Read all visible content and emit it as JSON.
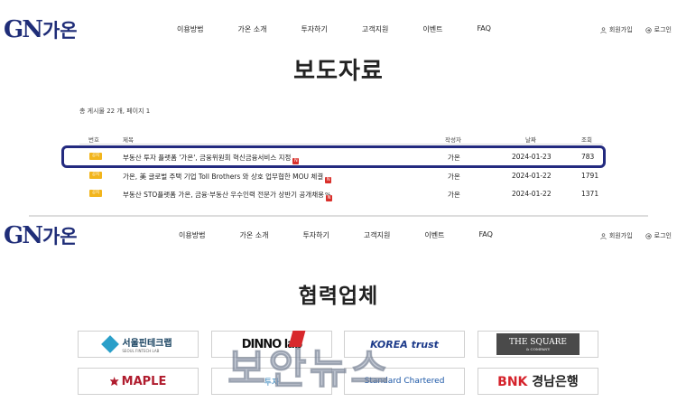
{
  "brand": {
    "logo_mark": "GN",
    "logo_text": "가온"
  },
  "nav": [
    "이용방법",
    "가온 소개",
    "투자하기",
    "고객지원",
    "이벤트",
    "FAQ"
  ],
  "util": {
    "signup": "회원가입",
    "login": "로그인"
  },
  "press": {
    "title": "보도자료",
    "count_text": "총 게시물 22 개, 페이지 1",
    "columns": {
      "no": "번호",
      "title": "제목",
      "author": "작성자",
      "date": "날짜",
      "views": "조회"
    },
    "badge": "공지",
    "new_mark": "N",
    "rows": [
      {
        "title": "부동산 투자 플랫폼 '가온', 금융위원회 혁신금융서비스 지정",
        "author": "가온",
        "date": "2024-01-23",
        "views": "783"
      },
      {
        "title": "가온, 美 글로벌 주택 기업 Toll Brothers 와 상호 업무협한 MOU 체결",
        "author": "가온",
        "date": "2024-01-22",
        "views": "1791"
      },
      {
        "title": "부동산 STO플랫폼 가온, 금융·부동산 우수인력 전문가 상반기 공개채용",
        "author": "가온",
        "date": "2024-01-22",
        "views": "1371"
      }
    ]
  },
  "partners": {
    "title": "협력업체",
    "items": [
      {
        "name": "서울핀테크랩",
        "sub": "SEOUL FINTECH LAB"
      },
      {
        "name": "DINNO lab"
      },
      {
        "name": "KOREA trust"
      },
      {
        "name": "THE SQUARE",
        "sub": "& COMPANY"
      },
      {
        "name": "MAPLE"
      },
      {
        "name": "투자"
      },
      {
        "name": "Standard Chartered"
      },
      {
        "name": "BNK",
        "sub": "경남은행"
      }
    ]
  },
  "watermark": "보안뉴스"
}
